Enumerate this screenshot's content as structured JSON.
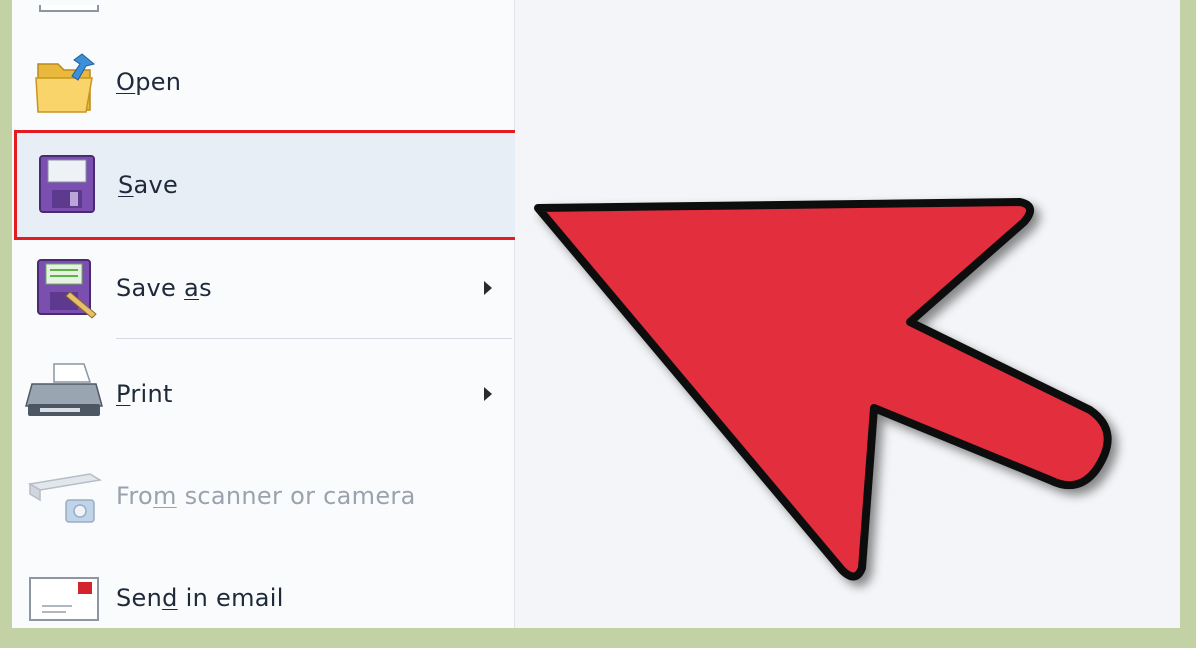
{
  "menu": {
    "items": [
      {
        "pre": "",
        "mnemonic": "O",
        "post": "pen",
        "has_submenu": false,
        "disabled": false
      },
      {
        "pre": "",
        "mnemonic": "S",
        "post": "ave",
        "has_submenu": false,
        "disabled": false,
        "highlighted": true
      },
      {
        "pre": "Save ",
        "mnemonic": "a",
        "post": "s",
        "has_submenu": true,
        "disabled": false
      },
      {
        "pre": "",
        "mnemonic": "P",
        "post": "rint",
        "has_submenu": true,
        "disabled": false
      },
      {
        "pre": "Fro",
        "mnemonic": "m",
        "post": " scanner or camera",
        "has_submenu": false,
        "disabled": true
      },
      {
        "pre": "Sen",
        "mnemonic": "d",
        "post": " in email",
        "has_submenu": false,
        "disabled": false
      }
    ]
  },
  "icons": {
    "open": "folder-open-icon",
    "save": "floppy-disk-icon",
    "save_as": "floppy-disk-pencil-icon",
    "print": "printer-icon",
    "scanner": "scanner-camera-icon",
    "email": "email-envelope-icon"
  },
  "colors": {
    "highlight_border": "#e51b24",
    "pointer_fill": "#e22d3e",
    "background_accent": "#c3d2a5"
  }
}
